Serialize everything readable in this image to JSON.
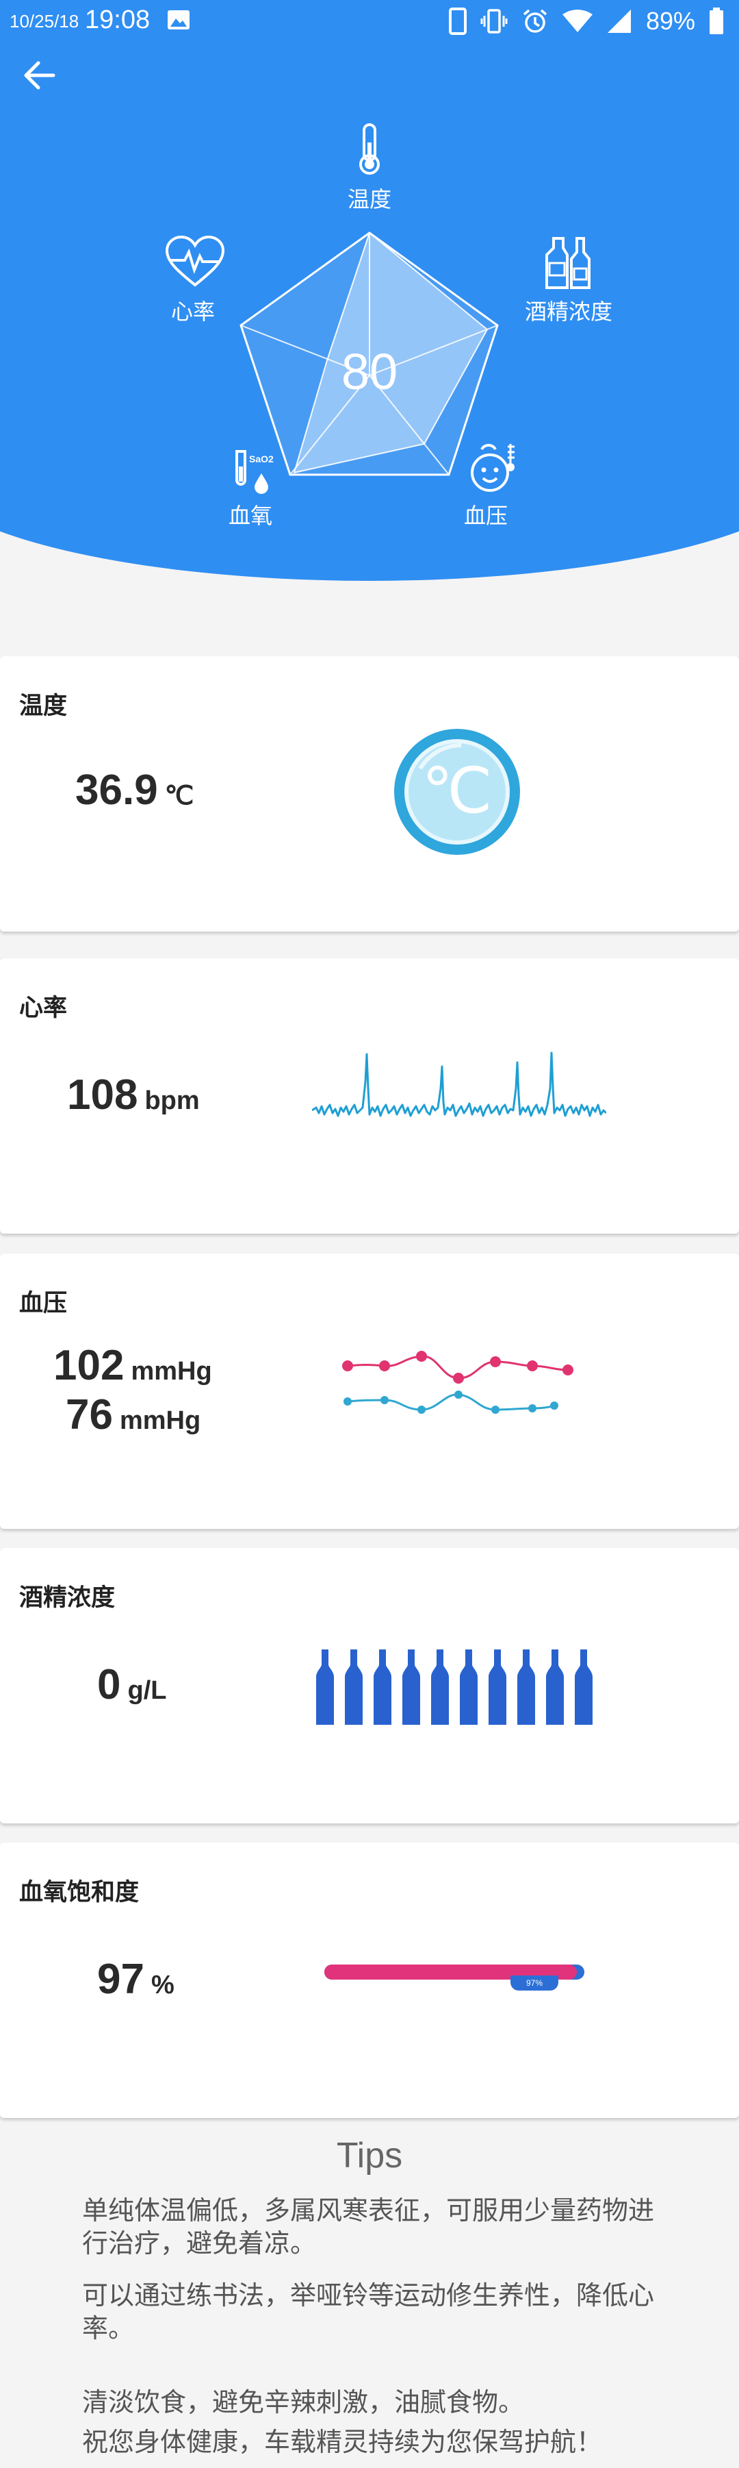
{
  "status_bar": {
    "date": "10/25/18",
    "time": "19:08",
    "battery": "89%"
  },
  "radar": {
    "score": "80",
    "labels": {
      "temperature": "温度",
      "alcohol": "酒精浓度",
      "blood_pressure": "血压",
      "blood_oxygen": "血氧",
      "heart_rate": "心率"
    }
  },
  "cards": {
    "temperature": {
      "title": "温度",
      "value": "36.9",
      "unit": "℃",
      "icon_text": "℃"
    },
    "heart_rate": {
      "title": "心率",
      "value": "108",
      "unit": "bpm"
    },
    "blood_pressure": {
      "title": "血压",
      "systolic": "102",
      "diastolic": "76",
      "unit": "mmHg"
    },
    "alcohol": {
      "title": "酒精浓度",
      "value": "0",
      "unit": "g/L"
    },
    "blood_oxygen": {
      "title": "血氧饱和度",
      "value": "97",
      "unit": "%",
      "bar_fill": 0.97,
      "bar_badge": "97%"
    }
  },
  "tips": {
    "title": "Tips",
    "items": [
      "单纯体温偏低，多属风寒表征，可服用少量药物进行治疗，避免着凉。",
      "可以通过练书法，举哑铃等运动修生养性，降低心率。",
      "清淡饮食，避免辛辣刺激，油腻食物。",
      "祝您身体健康，车载精灵持续为您保驾护航！"
    ]
  },
  "colors": {
    "header_blue": "#2f8ef2",
    "ecg": "#1e9fd3",
    "bp_high": "#e0336f",
    "bp_low": "#2fa7d1",
    "bottle": "#2962cf",
    "oxygen_bar": "#e0337b"
  },
  "icons": [
    "back-arrow-icon",
    "thermometer-icon",
    "bottles-icon",
    "face-icon",
    "test-tube-icon",
    "heart-pulse-icon",
    "celsius-icon",
    "image-icon",
    "phone-icon",
    "vibrate-icon",
    "alarm-icon",
    "wifi-icon",
    "signal-icon",
    "battery-icon"
  ]
}
